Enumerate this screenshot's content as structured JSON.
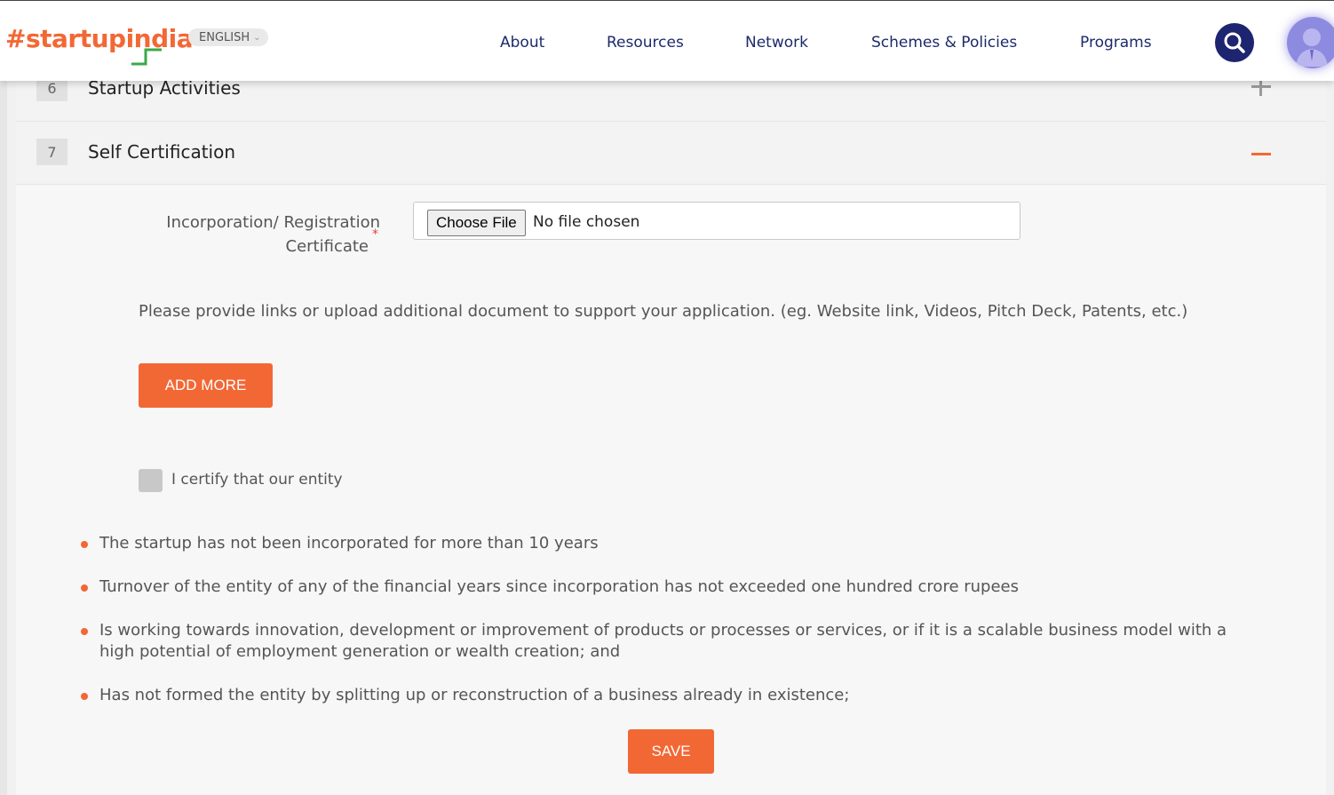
{
  "header": {
    "logo_text": "#startupindia",
    "language": "ENGLISH",
    "nav": {
      "about": "About",
      "resources": "Resources",
      "network": "Network",
      "schemes": "Schemes & Policies",
      "programs": "Programs"
    },
    "search_icon": "search-icon",
    "avatar_icon": "user-avatar-icon"
  },
  "accordion": {
    "section6": {
      "number": "6",
      "title": "Startup Activities",
      "toggle_icon": "plus-icon"
    },
    "section7": {
      "number": "7",
      "title": "Self Certification",
      "toggle_icon": "minus-icon"
    }
  },
  "form": {
    "certificate_label_line1": "Incorporation/ Registration",
    "certificate_label_line2": "Certificate",
    "required_mark": "*",
    "choose_file_label": "Choose File",
    "file_status": "No file chosen",
    "help_text": "Please provide links or upload additional document to support your application. (eg. Website link, Videos, Pitch Deck, Patents, etc.)",
    "add_more_label": "ADD MORE",
    "certify_label": "I certify that our entity",
    "certify_checked": false,
    "criteria": [
      "The startup has not been incorporated for more than 10 years",
      "Turnover of the entity of any of the financial years since incorporation has not exceeded one hundred crore rupees",
      "Is working towards innovation, development or improvement of products or processes or services, or if it is a scalable business model with a high potential of employment generation or wealth creation; and",
      "Has not formed the entity by splitting up or reconstruction of a business already in existence;"
    ],
    "save_label": "SAVE"
  },
  "colors": {
    "accent": "#f26835",
    "nav_text": "#1c2a6b",
    "search_bg": "#1d2470",
    "logo_green": "#3aa948"
  }
}
